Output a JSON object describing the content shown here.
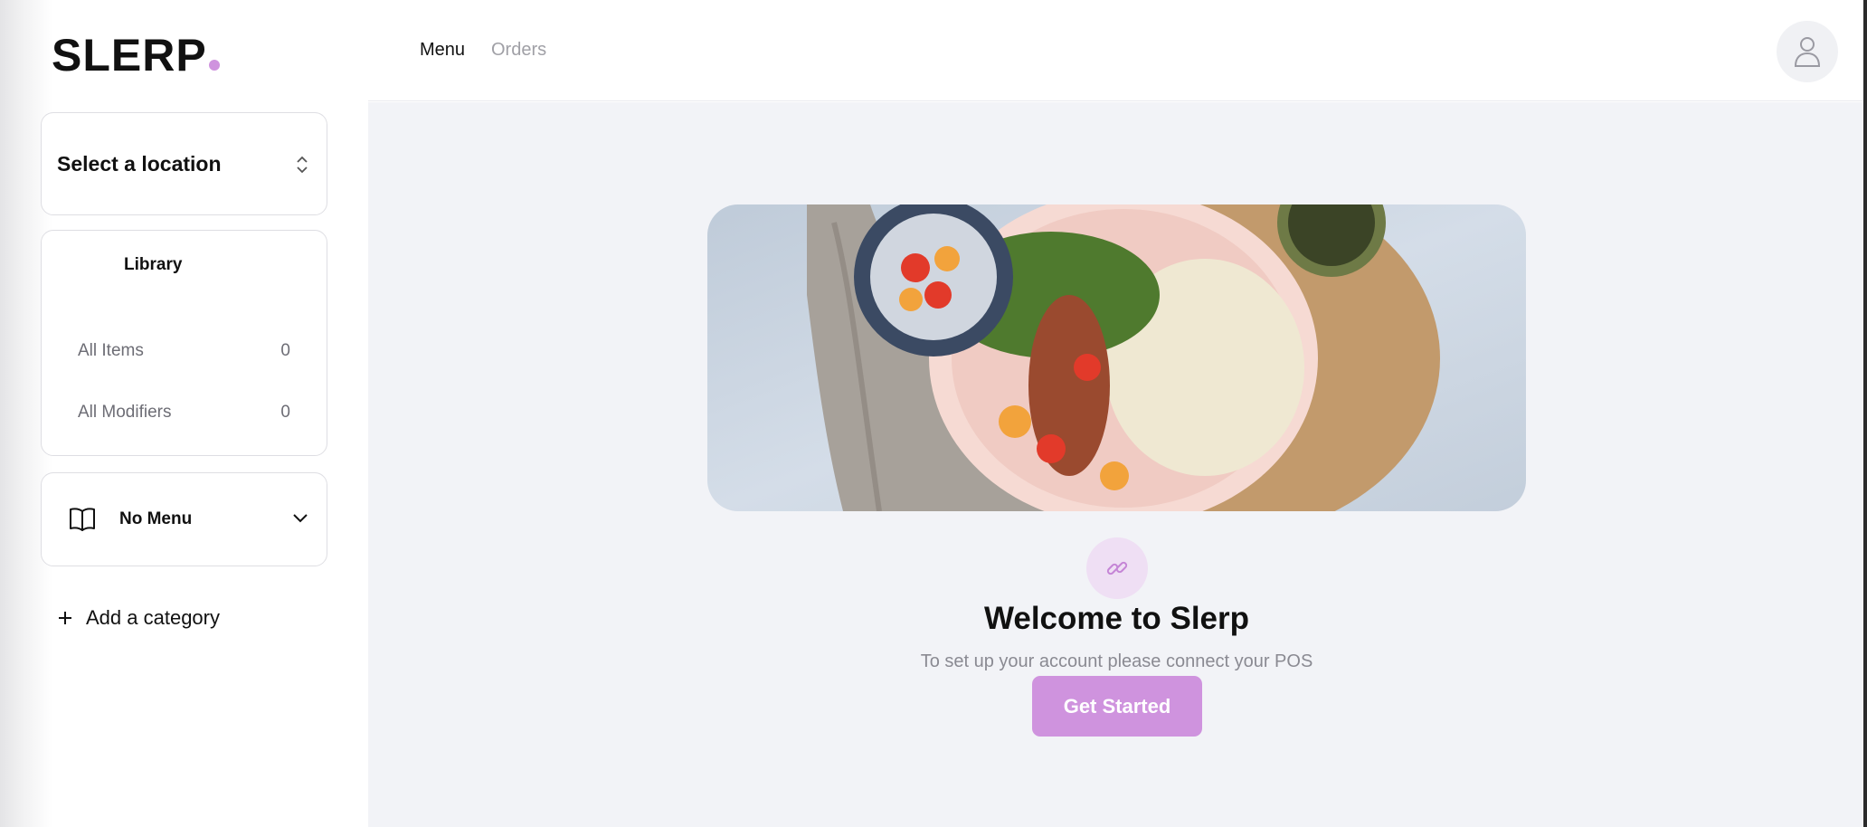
{
  "brand": {
    "name": "SLERP",
    "accent": "#cf93de"
  },
  "nav": {
    "tabs": [
      {
        "label": "Menu",
        "active": true
      },
      {
        "label": "Orders",
        "active": false
      }
    ]
  },
  "sidebar": {
    "location": {
      "label": "Select a location",
      "icon": "chevron-up-down-icon"
    },
    "library": {
      "title": "Library",
      "items": [
        {
          "label": "All Items",
          "count": "0"
        },
        {
          "label": "All Modifiers",
          "count": "0"
        }
      ]
    },
    "menu": {
      "label": "No Menu",
      "icon": "book-icon"
    },
    "add_category": {
      "label": "Add a category",
      "icon": "plus-icon"
    }
  },
  "main": {
    "hero_image": "food-bowl-photo",
    "icon": "link-icon",
    "title": "Welcome to Slerp",
    "subtitle": "To set up your account please connect your POS",
    "cta_label": "Get Started"
  },
  "user": {
    "icon": "user-icon"
  }
}
